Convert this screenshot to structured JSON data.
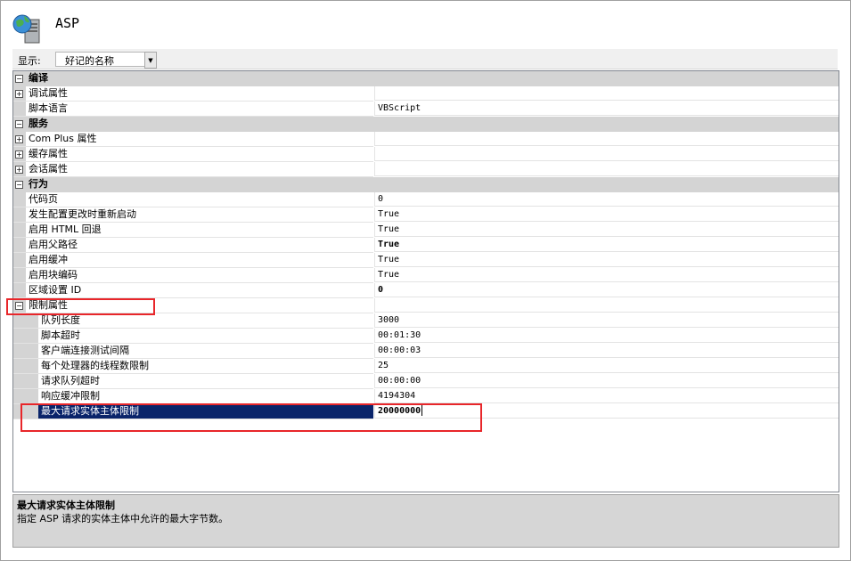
{
  "header": {
    "title": "ASP",
    "icon": "globe-server-icon"
  },
  "display": {
    "label": "显示:",
    "value": "好记的名称"
  },
  "rows": [
    {
      "type": "cat",
      "name": "编译"
    },
    {
      "type": "prop",
      "level": 1,
      "expander": "plus",
      "name": "调试属性",
      "value": ""
    },
    {
      "type": "prop",
      "level": 1,
      "name": "脚本语言",
      "value": "VBScript"
    },
    {
      "type": "cat",
      "name": "服务"
    },
    {
      "type": "prop",
      "level": 1,
      "expander": "plus",
      "name": "Com Plus 属性",
      "value": ""
    },
    {
      "type": "prop",
      "level": 1,
      "expander": "plus",
      "name": "缓存属性",
      "value": ""
    },
    {
      "type": "prop",
      "level": 1,
      "expander": "plus",
      "name": "会话属性",
      "value": ""
    },
    {
      "type": "cat",
      "name": "行为"
    },
    {
      "type": "prop",
      "level": 1,
      "name": "代码页",
      "value": "0"
    },
    {
      "type": "prop",
      "level": 1,
      "name": "发生配置更改时重新启动",
      "value": "True"
    },
    {
      "type": "prop",
      "level": 1,
      "name": "启用 HTML 回退",
      "value": "True"
    },
    {
      "type": "prop",
      "level": 1,
      "name": "启用父路径",
      "value": "True",
      "bold": true
    },
    {
      "type": "prop",
      "level": 1,
      "name": "启用缓冲",
      "value": "True"
    },
    {
      "type": "prop",
      "level": 1,
      "name": "启用块编码",
      "value": "True"
    },
    {
      "type": "prop",
      "level": 1,
      "name": "区域设置 ID",
      "value": "0",
      "bold": true
    },
    {
      "type": "prop",
      "level": 1,
      "expander": "minus",
      "name": "限制属性",
      "value": ""
    },
    {
      "type": "prop",
      "level": 2,
      "name": "队列长度",
      "value": "3000"
    },
    {
      "type": "prop",
      "level": 2,
      "name": "脚本超时",
      "value": "00:01:30"
    },
    {
      "type": "prop",
      "level": 2,
      "name": "客户端连接测试间隔",
      "value": "00:00:03"
    },
    {
      "type": "prop",
      "level": 2,
      "name": "每个处理器的线程数限制",
      "value": "25"
    },
    {
      "type": "prop",
      "level": 2,
      "name": "请求队列超时",
      "value": "00:00:00"
    },
    {
      "type": "prop",
      "level": 2,
      "name": "响应缓冲限制",
      "value": "4194304"
    },
    {
      "type": "prop",
      "level": 2,
      "name": "最大请求实体主体限制",
      "value": "20000000",
      "bold": true,
      "selected": true
    }
  ],
  "description": {
    "title": "最大请求实体主体限制",
    "text": "指定 ASP 请求的实体主体中允许的最大字节数。"
  },
  "colors": {
    "selection": "#0a246a",
    "category": "#d4d4d4",
    "highlight_box": "#e8262a"
  }
}
